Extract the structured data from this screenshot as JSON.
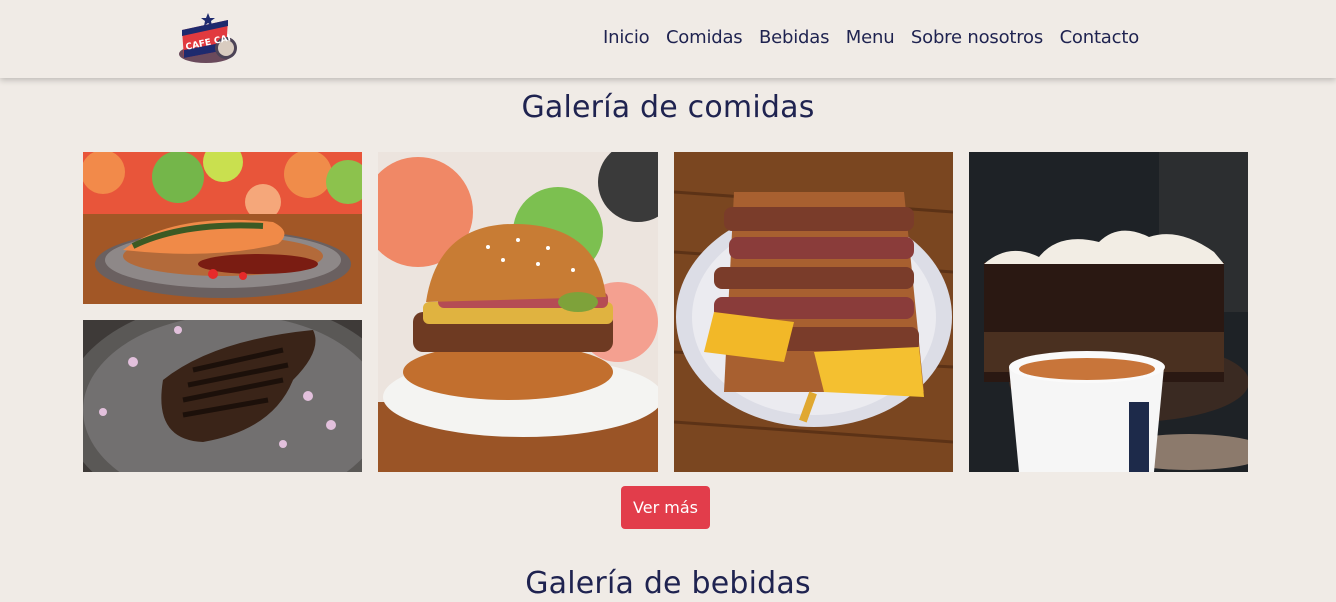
{
  "brand": {
    "logo_text": "CAFE CAI",
    "logo_alt": "Cafe Cai logo"
  },
  "nav": {
    "items": [
      "Inicio",
      "Comidas",
      "Bebidas",
      "Menu",
      "Sobre nosotros",
      "Contacto"
    ]
  },
  "gallery_food": {
    "title": "Galería de comidas",
    "images": [
      {
        "alt": "Salmón grillado sobre vegetales"
      },
      {
        "alt": "Bife a la parrilla con pétalos"
      },
      {
        "alt": "Hamburguesa con queso y panceta"
      },
      {
        "alt": "Sandwich de carne con queso y papas"
      },
      {
        "alt": "Torta de chocolate con merengue y café"
      }
    ],
    "more_button": "Ver más"
  },
  "gallery_drinks": {
    "title": "Galería de bebidas"
  },
  "colors": {
    "background": "#f0ebe6",
    "text": "#1f2350",
    "accent": "#e23d4b"
  },
  "icons": {
    "logo": "cafe-logo-icon"
  }
}
